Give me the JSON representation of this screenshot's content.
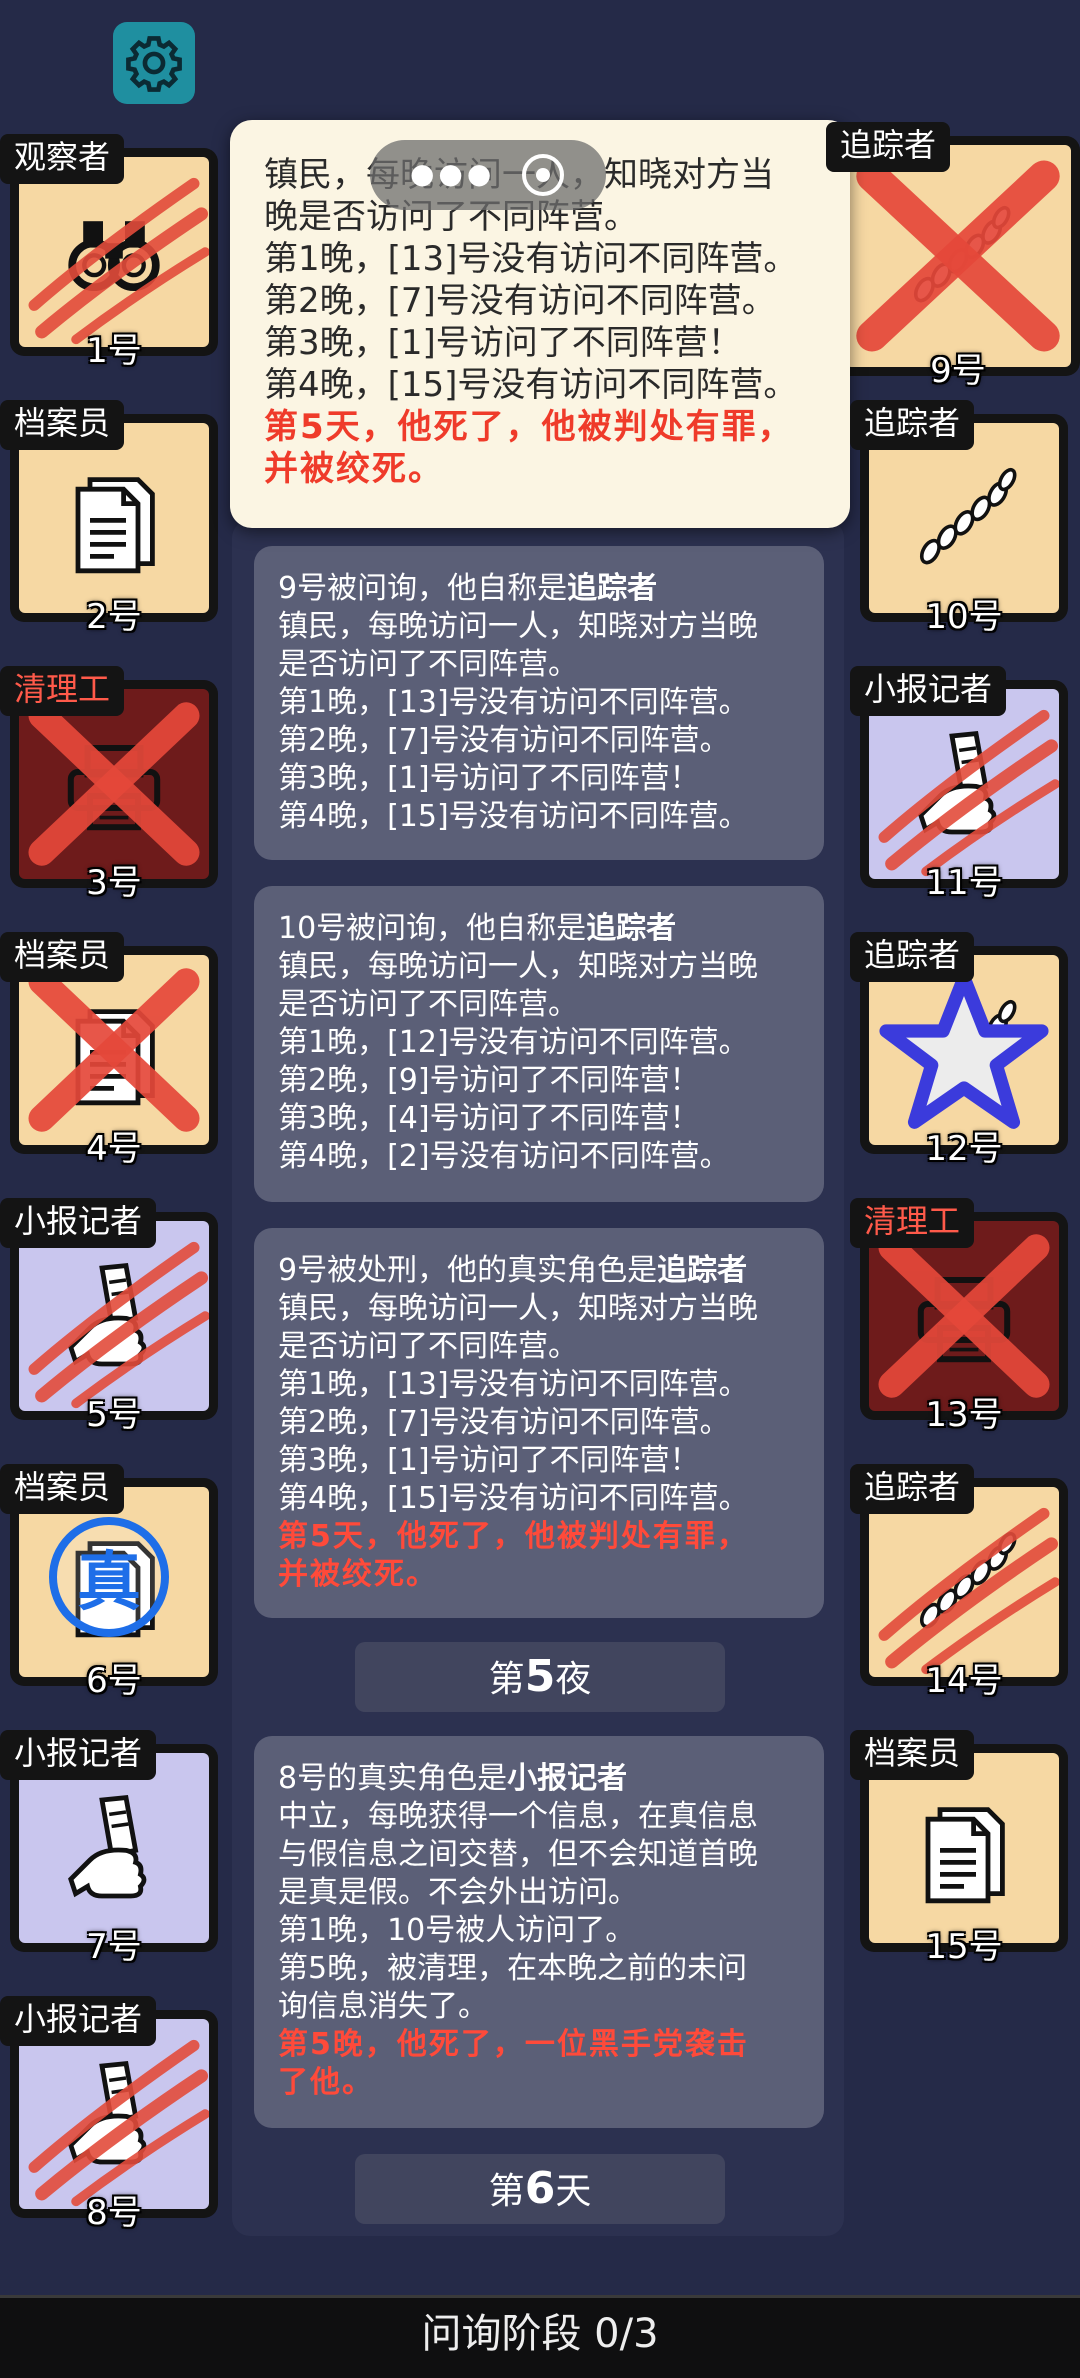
{
  "settings_icon": "gear-icon",
  "popup": {
    "lines": [
      "镇民，每晚访问一人，知晓对方当",
      "晚是否访问了不同阵营。",
      "第1晚，[13]号没有访问不同阵营。",
      "第2晚，[7]号没有访问不同阵营。",
      "第3晚，[1]号访问了不同阵营！",
      "第4晚，[15]号没有访问不同阵营。"
    ],
    "red_lines": [
      "第5天，他死了，他被判处有罪，",
      "并被绞死。"
    ]
  },
  "left_cards": [
    {
      "role": "观察者",
      "num": "1号",
      "icon": "binoculars-icon",
      "bg": "#f6d8a3",
      "overlay": "claw"
    },
    {
      "role": "档案员",
      "num": "2号",
      "icon": "documents-icon",
      "bg": "#f6d8a3",
      "overlay": "none"
    },
    {
      "role": "清理工",
      "num": "3号",
      "icon": "printer-icon",
      "bg": "#6e1b1b",
      "overlay": "cross",
      "role_color": "#ff5a4a"
    },
    {
      "role": "档案员",
      "num": "4号",
      "icon": "documents-icon",
      "bg": "#f6d8a3",
      "overlay": "cross"
    },
    {
      "role": "小报记者",
      "num": "5号",
      "icon": "scroll-hand-icon",
      "bg": "#c9c6ee",
      "overlay": "claw"
    },
    {
      "role": "档案员",
      "num": "6号",
      "icon": "truth-stamp-icon",
      "bg": "#f6d8a3",
      "overlay": "stamp",
      "stamp_text": "真"
    },
    {
      "role": "小报记者",
      "num": "7号",
      "icon": "scroll-hand-icon",
      "bg": "#c9c6ee",
      "overlay": "none"
    },
    {
      "role": "小报记者",
      "num": "8号",
      "icon": "scroll-hand-icon",
      "bg": "#c9c6ee",
      "overlay": "claw"
    }
  ],
  "right_cards": [
    {
      "role": "追踪者",
      "num": "9号",
      "icon": "footprints-icon",
      "bg": "#f6d8a3",
      "overlay": "cross"
    },
    {
      "role": "追踪者",
      "num": "10号",
      "icon": "footprints-icon",
      "bg": "#f6d8a3",
      "overlay": "none"
    },
    {
      "role": "小报记者",
      "num": "11号",
      "icon": "scroll-hand-icon",
      "bg": "#c9c6ee",
      "overlay": "claw"
    },
    {
      "role": "追踪者",
      "num": "12号",
      "icon": "footprints-icon",
      "bg": "#f6d8a3",
      "overlay": "star"
    },
    {
      "role": "清理工",
      "num": "13号",
      "icon": "printer-icon",
      "bg": "#6e1b1b",
      "overlay": "cross",
      "role_color": "#ff5a4a"
    },
    {
      "role": "追踪者",
      "num": "14号",
      "icon": "footprints-icon",
      "bg": "#f6d8a3",
      "overlay": "claw"
    },
    {
      "role": "档案员",
      "num": "15号",
      "icon": "documents-icon",
      "bg": "#f6d8a3",
      "overlay": "none"
    }
  ],
  "log": {
    "box1": {
      "prefix": "9号被问询，他自称是",
      "role": "追踪者",
      "lines": [
        "镇民，每晚访问一人，知晓对方当晚",
        "是否访问了不同阵营。",
        "第1晚，[13]号没有访问不同阵营。",
        "第2晚，[7]号没有访问不同阵营。",
        "第3晚，[1]号访问了不同阵营！",
        "第4晚，[15]号没有访问不同阵营。"
      ]
    },
    "box2": {
      "prefix": "10号被问询，他自称是",
      "role": "追踪者",
      "lines": [
        "镇民，每晚访问一人，知晓对方当晚",
        "是否访问了不同阵营。",
        "第1晚，[12]号没有访问不同阵营。",
        "第2晚，[9]号访问了不同阵营！",
        "第3晚，[4]号访问了不同阵营！",
        "第4晚，[2]号没有访问不同阵营。"
      ]
    },
    "box3": {
      "prefix": "9号被处刑，他的真实角色是",
      "role": "追踪者",
      "lines": [
        "镇民，每晚访问一人，知晓对方当晚",
        "是否访问了不同阵营。",
        "第1晚，[13]号没有访问不同阵营。",
        "第2晚，[7]号没有访问不同阵营。",
        "第3晚，[1]号访问了不同阵营！",
        "第4晚，[15]号没有访问不同阵营。"
      ],
      "red_lines": [
        "第5天，他死了，他被判处有罪，",
        "并被绞死。"
      ]
    },
    "sep1": {
      "pre": "第",
      "num": "5",
      "post": "夜"
    },
    "box4": {
      "prefix": "8号的真实角色是",
      "role": "小报记者",
      "lines": [
        "中立，每晚获得一个信息，在真信息",
        "与假信息之间交替，但不会知道首晚",
        "是真是假。不会外出访问。",
        "第1晚，10号被人访问了。",
        "第5晚，被清理，在本晚之前的未问",
        "询信息消失了。"
      ],
      "red_lines": [
        "第5晚，他死了，一位黑手党袭击",
        "了他。"
      ]
    },
    "sep2": {
      "pre": "第",
      "num": "6",
      "post": "天"
    }
  },
  "bottom_bar": {
    "label": "问询阶段 0/3"
  }
}
